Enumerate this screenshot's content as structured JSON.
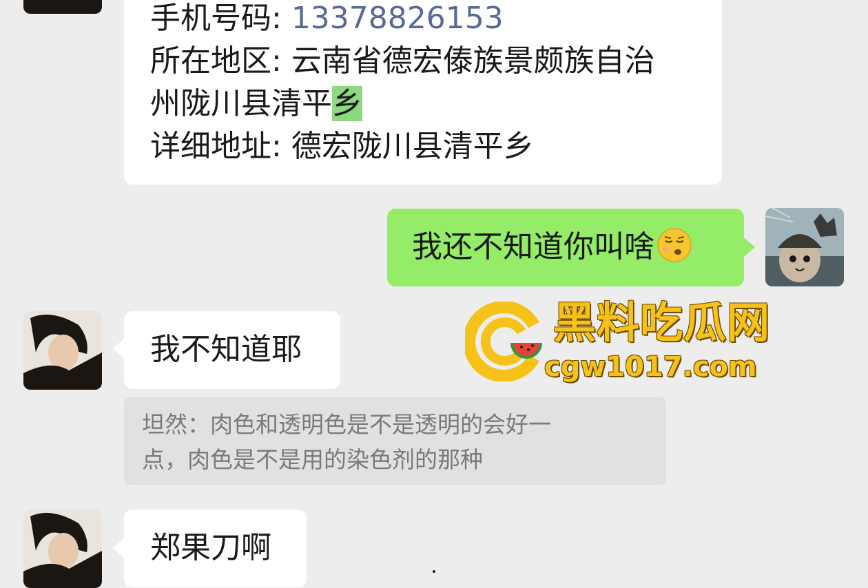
{
  "info_card": {
    "phone_label": "手机号码: ",
    "phone_value": "13378826153",
    "region_label": "所在地区: ",
    "region_line1": "云南省德宏傣族景颇族自治",
    "region_line2_a": "州陇川县清平",
    "region_line2_hl": "乡",
    "address_label": "详细地址: ",
    "address_value": "德宏陇川县清平乡"
  },
  "messages": [
    {
      "side": "right",
      "text": "我还不知道你叫啥",
      "emoji": "smirk-emoji"
    },
    {
      "side": "left",
      "text": "我不知道耶"
    },
    {
      "side": "left",
      "text": "郑果刀啊"
    }
  ],
  "quote": {
    "line1": "坦然：肉色和透明色是不是透明的会好一",
    "line2": "点，肉色是不是用的染色剂的那种"
  },
  "watermark": {
    "title": "黑料吃瓜网",
    "url": "cgw1017.com"
  },
  "colors": {
    "background": "#ededed",
    "bubble_self": "#95ec69",
    "bubble_other": "#ffffff",
    "phone_link": "#576b95",
    "watermark": "#f6c21a"
  }
}
